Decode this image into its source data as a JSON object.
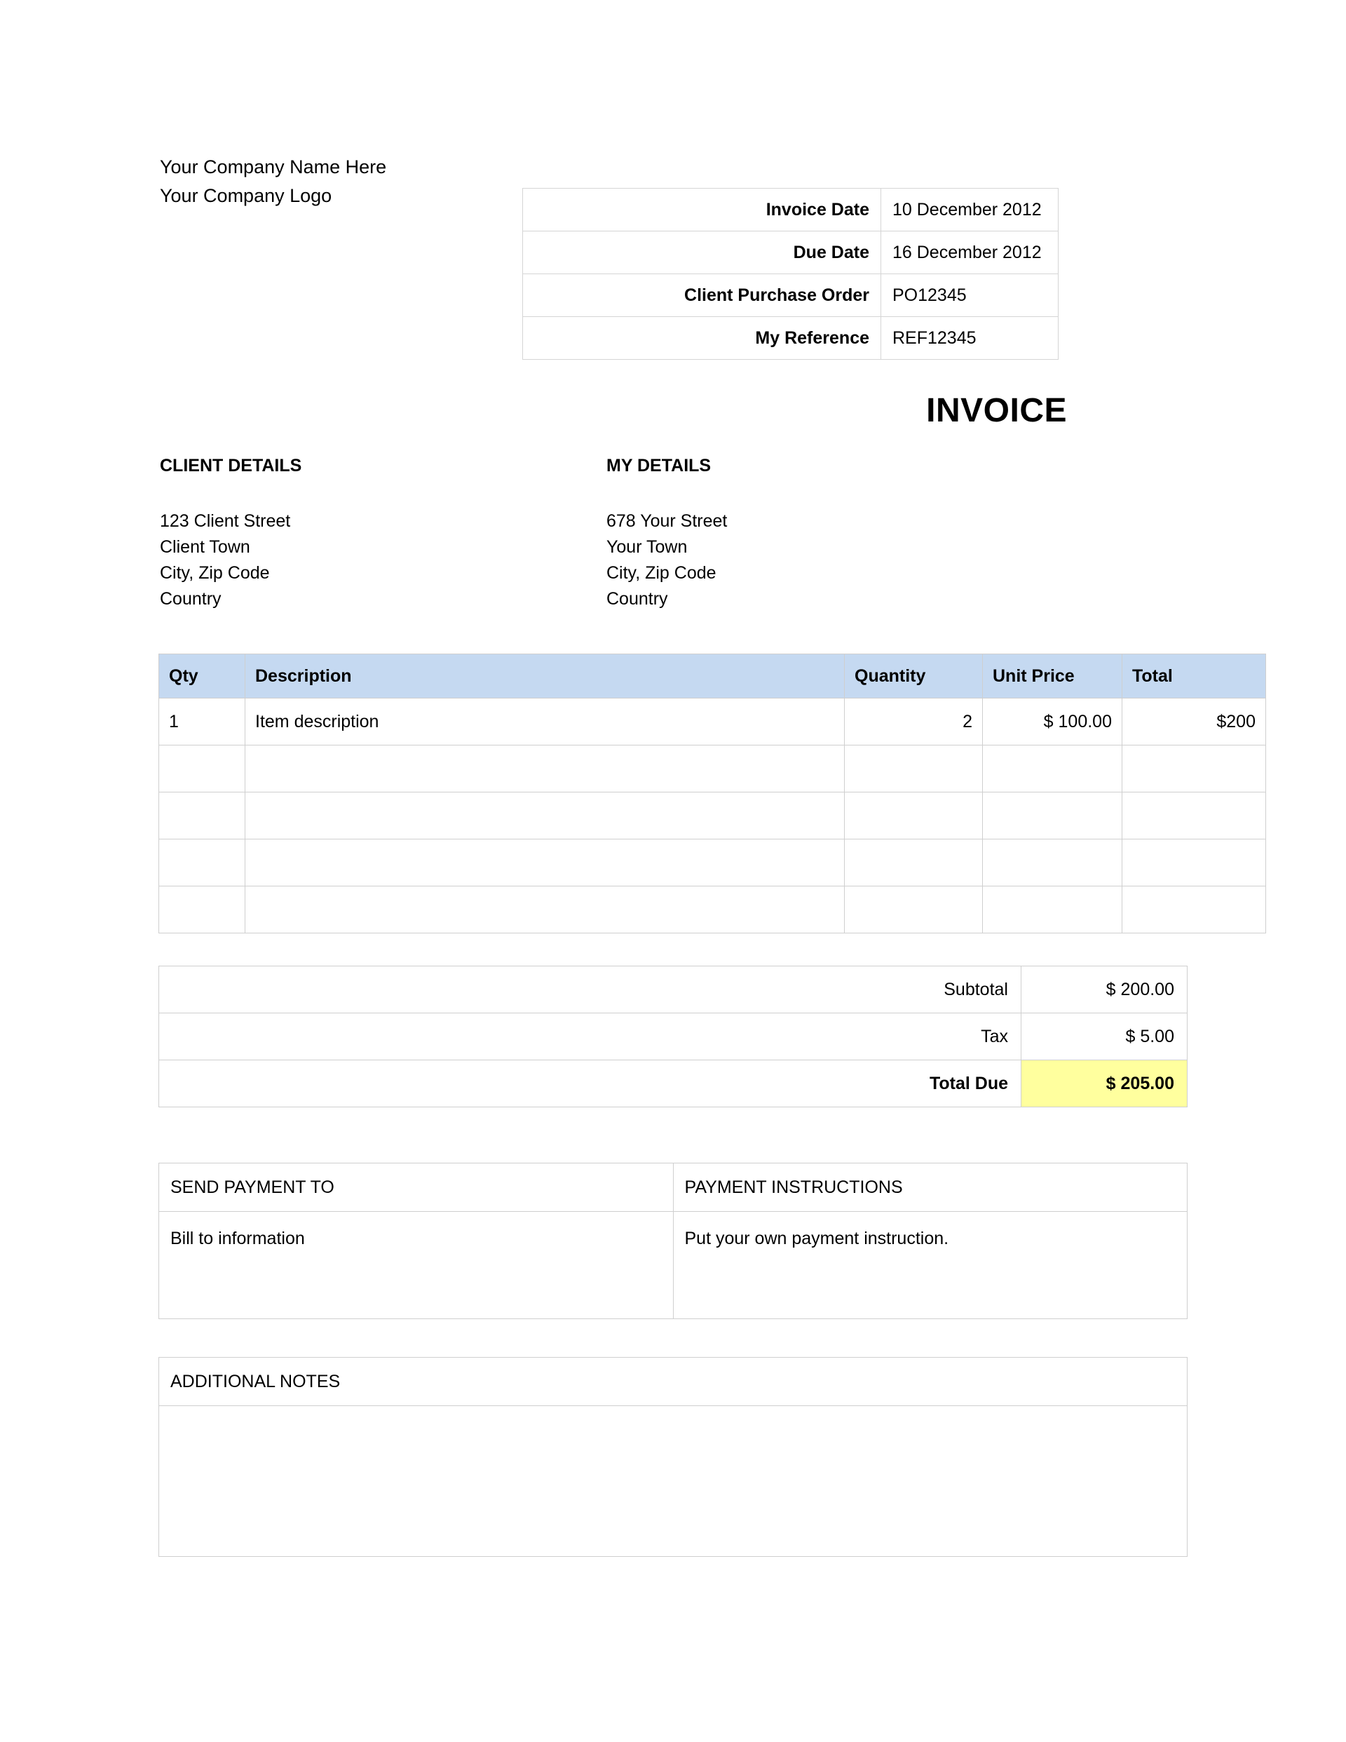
{
  "company": {
    "name_line": "Your Company Name Here",
    "logo_line": "Your Company Logo"
  },
  "details": {
    "rows": [
      {
        "label": "Invoice Date",
        "value": "10 December  2012"
      },
      {
        "label": "Due Date",
        "value": "16 December  2012"
      },
      {
        "label": "Client Purchase Order",
        "value": "PO12345"
      },
      {
        "label": "My Reference",
        "value": "REF12345"
      }
    ]
  },
  "title": "INVOICE",
  "parties": {
    "client": {
      "heading": "CLIENT DETAILS",
      "lines": [
        "123 Client Street",
        "Client Town",
        "City, Zip Code",
        "Country"
      ]
    },
    "mine": {
      "heading": "MY DETAILS",
      "lines": [
        "678 Your Street",
        "Your Town",
        "City, Zip Code",
        "Country"
      ]
    }
  },
  "items": {
    "headers": [
      "Qty",
      "Description",
      "Quantity",
      "Unit Price",
      "Total"
    ],
    "rows": [
      {
        "qty": "1",
        "description": "Item description",
        "quantity": "2",
        "unit_price": "$ 100.00",
        "total": "$200"
      },
      {
        "qty": "",
        "description": "",
        "quantity": "",
        "unit_price": "",
        "total": ""
      },
      {
        "qty": "",
        "description": "",
        "quantity": "",
        "unit_price": "",
        "total": ""
      },
      {
        "qty": "",
        "description": "",
        "quantity": "",
        "unit_price": "",
        "total": ""
      },
      {
        "qty": "",
        "description": "",
        "quantity": "",
        "unit_price": "",
        "total": ""
      }
    ]
  },
  "summary": {
    "subtotal_label": "Subtotal",
    "subtotal_value": "$ 200.00",
    "tax_label": "Tax",
    "tax_value": "$ 5.00",
    "total_due_label": "Total Due",
    "total_due_value": "$ 205.00"
  },
  "payment": {
    "send_payment_heading": "SEND PAYMENT TO",
    "send_payment_body": "Bill to information",
    "instructions_heading": "PAYMENT INSTRUCTIONS",
    "instructions_body": "Put your own payment instruction."
  },
  "notes": {
    "heading": "ADDITIONAL NOTES",
    "body": ""
  },
  "colors": {
    "table_header_blue": "#c5d9f1",
    "total_due_yellow": "#ffff9e",
    "border_gray": "#cfcfcf"
  }
}
